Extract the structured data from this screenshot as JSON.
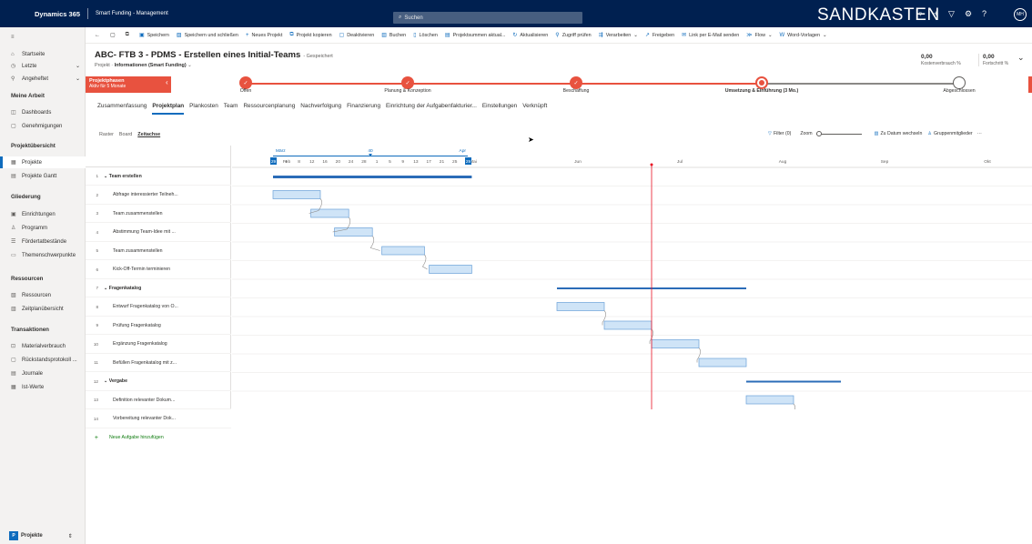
{
  "topbar": {
    "brand": "Dynamics 365",
    "app_name": "Smart Funding - Management",
    "search_placeholder": "Suchen",
    "environment": "SANDKASTEN",
    "avatar_initials": "MH"
  },
  "sidebar": {
    "items_top": [
      {
        "label": "Startseite"
      },
      {
        "label": "Letzte"
      },
      {
        "label": "Angeheftet"
      }
    ],
    "section_meine_arbeit": "Meine Arbeit",
    "meine_arbeit": [
      {
        "label": "Dashboards"
      },
      {
        "label": "Genehmigungen"
      }
    ],
    "section_projektuebersicht": "Projektübersicht",
    "projektuebersicht": [
      {
        "label": "Projekte"
      },
      {
        "label": "Projekte Gantt"
      }
    ],
    "section_gliederung": "Gliederung",
    "gliederung": [
      {
        "label": "Einrichtungen"
      },
      {
        "label": "Programm"
      },
      {
        "label": "Fördertatbestände"
      },
      {
        "label": "Themenschwerpunkte"
      }
    ],
    "section_ressourcen": "Ressourcen",
    "ressourcen": [
      {
        "label": "Ressourcen"
      },
      {
        "label": "Zeitplanübersicht"
      }
    ],
    "section_transaktionen": "Transaktionen",
    "transaktionen": [
      {
        "label": "Materialverbrauch"
      },
      {
        "label": "Rückstandsprotokoll ..."
      },
      {
        "label": "Journale"
      },
      {
        "label": "Ist-Werte"
      }
    ],
    "area_badge": "P",
    "area_label": "Projekte"
  },
  "commands": [
    {
      "label": "Speichern"
    },
    {
      "label": "Speichern und schließen"
    },
    {
      "label": "Neues Projekt"
    },
    {
      "label": "Projekt kopieren"
    },
    {
      "label": "Deaktivieren"
    },
    {
      "label": "Buchen"
    },
    {
      "label": "Löschen"
    },
    {
      "label": "Projektsummen aktual..."
    },
    {
      "label": "Aktualisieren"
    },
    {
      "label": "Zugriff prüfen"
    },
    {
      "label": "Verarbeiten"
    },
    {
      "label": "Freigeben"
    },
    {
      "label": "Link per E-Mail senden"
    },
    {
      "label": "Flow"
    },
    {
      "label": "Word-Vorlagen"
    }
  ],
  "record": {
    "title": "ABC- FTB 3 - PDMS - Erstellen eines Initial-Teams",
    "saved_status": "- Gespeichert",
    "entity": "Projekt",
    "form": "Informationen (Smart Funding)",
    "cost_value": "0,00",
    "cost_label": "Kostenverbrauch %",
    "progress_value": "0,00",
    "progress_label": "Fortschritt %"
  },
  "bpf": {
    "active_name": "Projektphasen",
    "active_duration": "Aktiv für 5 Monate",
    "stages": [
      {
        "label": "Offen"
      },
      {
        "label": "Planung & Konzeption"
      },
      {
        "label": "Beschaffung"
      },
      {
        "label": "Umsetzung & Einführung (3 Mo.)"
      },
      {
        "label": "Abgeschlossen"
      }
    ]
  },
  "tabs": [
    {
      "label": "Zusammenfassung"
    },
    {
      "label": "Projektplan"
    },
    {
      "label": "Plankosten"
    },
    {
      "label": "Team"
    },
    {
      "label": "Ressourcenplanung"
    },
    {
      "label": "Nachverfolgung"
    },
    {
      "label": "Finanzierung"
    },
    {
      "label": "Einrichtung der Aufgabenfakturier..."
    },
    {
      "label": "Einstellungen"
    },
    {
      "label": "Verknüpft"
    }
  ],
  "views": [
    {
      "label": "Raster"
    },
    {
      "label": "Board"
    },
    {
      "label": "Zeitachse"
    }
  ],
  "toolbar": {
    "filter": "Filter (0)",
    "zoom": "Zoom",
    "goto_date": "Zu Datum wechseln",
    "group_members": "Gruppenmitglieder",
    "more": "···"
  },
  "chart_data": {
    "type": "gantt",
    "scale": {
      "top_labels": [
        "März",
        "40",
        "Apr"
      ],
      "months": [
        "Feb",
        "Mai",
        "Jun",
        "Jul",
        "Aug",
        "Sep",
        "Okt"
      ],
      "days": [
        "29",
        "4",
        "8",
        "12",
        "16",
        "20",
        "24",
        "28",
        "1",
        "5",
        "9",
        "13",
        "17",
        "21",
        "25",
        "29"
      ]
    },
    "rows": [
      {
        "num": "1",
        "name": "Team erstellen",
        "group": true,
        "start": 0.0,
        "end": 4.2
      },
      {
        "num": "2",
        "name": "Abfrage interessierter Teilneh...",
        "group": false,
        "start": 0.0,
        "end": 1.0
      },
      {
        "num": "3",
        "name": "Team zusammenstellen",
        "group": false,
        "start": 0.8,
        "end": 1.6
      },
      {
        "num": "4",
        "name": "Abstimmung Team-Idee mit ...",
        "group": false,
        "start": 1.3,
        "end": 2.1
      },
      {
        "num": "5",
        "name": "Team zusammenstellen",
        "group": false,
        "start": 2.3,
        "end": 3.2
      },
      {
        "num": "6",
        "name": "Kick-Off-Termin terminieren",
        "group": false,
        "start": 3.3,
        "end": 4.2
      },
      {
        "num": "7",
        "name": "Fragenkatalog",
        "group": true,
        "start": 6.0,
        "end": 10.0
      },
      {
        "num": "8",
        "name": "Entwurf Fragenkatalog von O...",
        "group": false,
        "start": 6.0,
        "end": 7.0
      },
      {
        "num": "9",
        "name": "Prüfung Fragenkatalog",
        "group": false,
        "start": 7.0,
        "end": 8.0
      },
      {
        "num": "10",
        "name": "Ergänzung Fragenkatalog",
        "group": false,
        "start": 8.0,
        "end": 9.0
      },
      {
        "num": "11",
        "name": "Befüllen Fragenkatalog mit z...",
        "group": false,
        "start": 9.0,
        "end": 10.0
      },
      {
        "num": "12",
        "name": "Vergabe",
        "group": true,
        "start": 10.0,
        "end": 12.0
      },
      {
        "num": "13",
        "name": "Definition relevanter Dokum...",
        "group": false,
        "start": 10.0,
        "end": 11.0
      },
      {
        "num": "14",
        "name": "Vorbereitung relevanter Dok...",
        "group": false,
        "start": 11.0,
        "end": 12.0
      }
    ],
    "add_task": "Neue Aufgabe hinzufügen",
    "today_marker_month_index": 8.0
  }
}
